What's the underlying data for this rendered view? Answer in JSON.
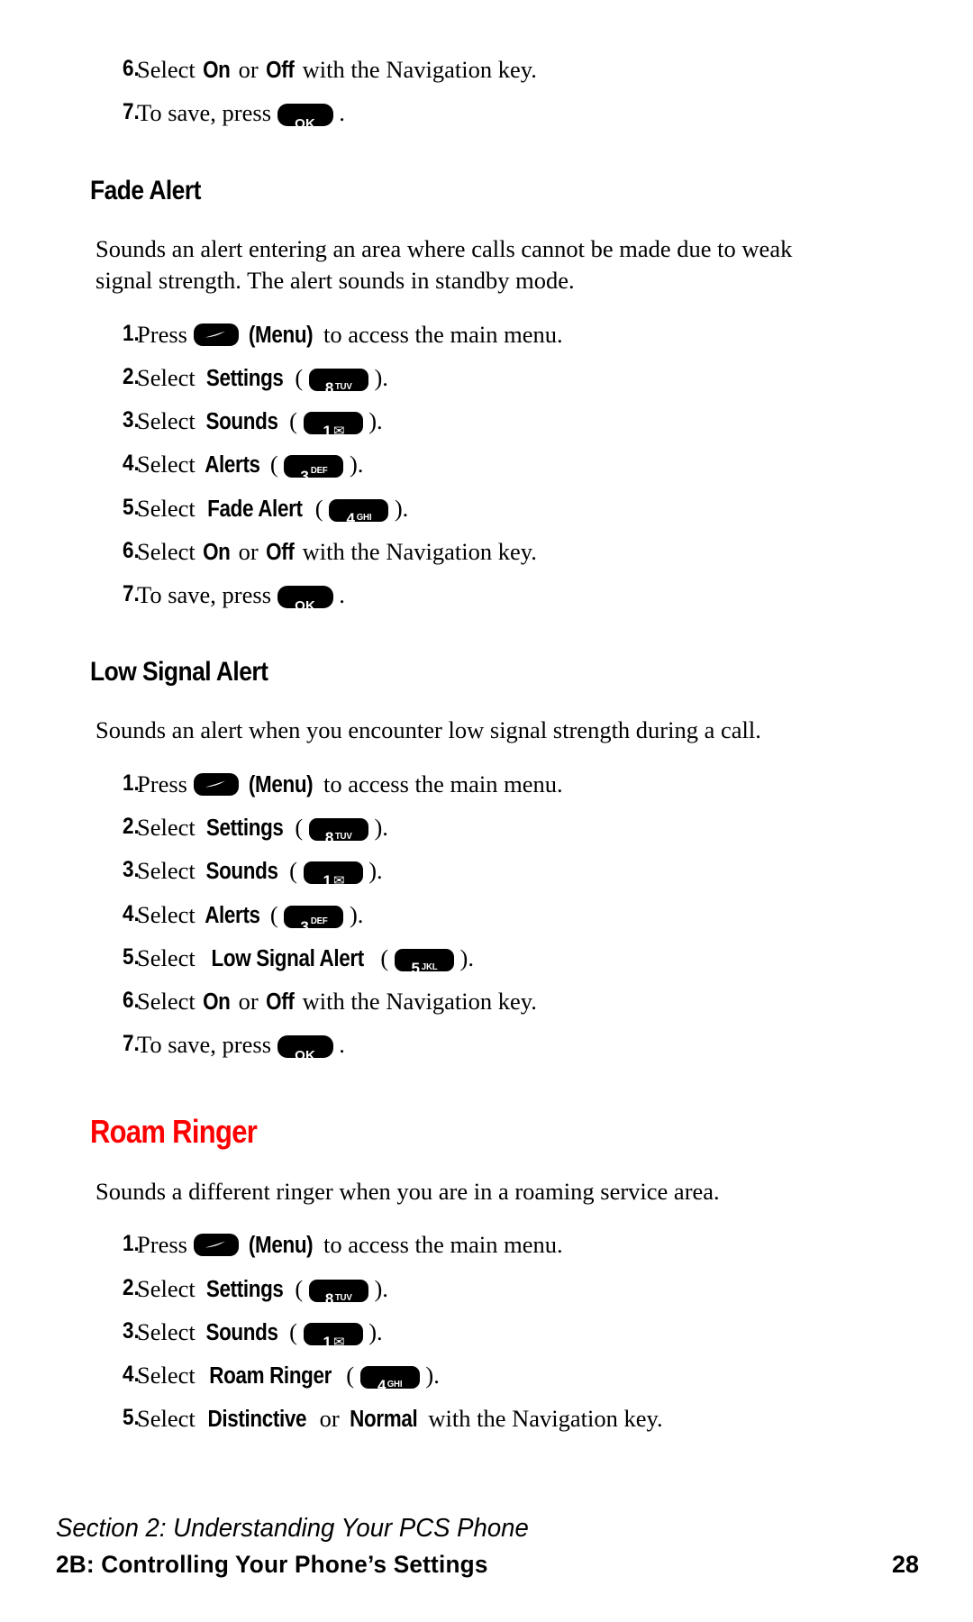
{
  "page": {
    "number": "28",
    "accent_color": "#ff0000",
    "text_color": "#000000",
    "background": "#ffffff"
  },
  "top_steps": [
    {
      "num": "6.",
      "pre": "Select ",
      "bold1": "On",
      "mid": " or ",
      "bold2": "Off",
      "post": " with the Navigation key."
    },
    {
      "num": "7.",
      "pre": "To save, press ",
      "key": "OK",
      "post": " ."
    }
  ],
  "sections": [
    {
      "heading": "Fade Alert",
      "heading_color": "#000000",
      "body": "Sounds an alert entering an area where calls cannot be made due to weak signal strength. The alert sounds in standby mode.",
      "steps": [
        {
          "num": "1.",
          "pre": "Press ",
          "key_type": "menu",
          "post_bold": "(Menu)",
          "post": " to access the main menu."
        },
        {
          "num": "2.",
          "pre": "Select ",
          "bold": "Settings",
          "paren_open": " ( ",
          "key_digit": "8",
          "key_letters": "TUV",
          "paren_close": " )."
        },
        {
          "num": "3.",
          "pre": "Select ",
          "bold": "Sounds",
          "paren_open": " ( ",
          "key_digit": "1",
          "key_letters": "envelope-glyph",
          "paren_close": " )."
        },
        {
          "num": "4.",
          "pre": "Select ",
          "bold": "Alerts",
          "paren_open": " ( ",
          "key_digit": "3",
          "key_letters": "DEF",
          "paren_close": " )."
        },
        {
          "num": "5.",
          "pre": "Select ",
          "bold": "Fade Alert",
          "paren_open": " ( ",
          "key_digit": "4",
          "key_letters": "GHI",
          "paren_close": " )."
        },
        {
          "num": "6.",
          "pre": "Select ",
          "bold": "On",
          "mid": " or ",
          "bold2": "Off",
          "post": " with the Navigation key."
        },
        {
          "num": "7.",
          "pre": "To save, press ",
          "key_ok": "OK",
          "post": " ."
        }
      ]
    },
    {
      "heading": "Low Signal Alert",
      "heading_color": "#000000",
      "body": "Sounds an alert when you encounter low signal strength during a call.",
      "steps": [
        {
          "num": "1.",
          "pre": "Press ",
          "key_type": "menu",
          "post_bold": "(Menu)",
          "post": " to access the main menu."
        },
        {
          "num": "2.",
          "pre": "Select ",
          "bold": "Settings",
          "paren_open": " ( ",
          "key_digit": "8",
          "key_letters": "TUV",
          "paren_close": " )."
        },
        {
          "num": "3.",
          "pre": "Select ",
          "bold": "Sounds",
          "paren_open": " ( ",
          "key_digit": "1",
          "key_letters": "envelope-glyph",
          "paren_close": " )."
        },
        {
          "num": "4.",
          "pre": "Select ",
          "bold": "Alerts",
          "paren_open": " ( ",
          "key_digit": "3",
          "key_letters": "DEF",
          "paren_close": " )."
        },
        {
          "num": "5.",
          "pre": "Select ",
          "bold": "Low Signal Alert",
          "paren_open": " ( ",
          "key_digit": "5",
          "key_letters": "JKL",
          "paren_close": " )."
        },
        {
          "num": "6.",
          "pre": "Select ",
          "bold": "On",
          "mid": " or ",
          "bold2": "Off",
          "post": " with the Navigation key."
        },
        {
          "num": "7.",
          "pre": "To save, press ",
          "key_ok": "OK",
          "post": " ."
        }
      ]
    }
  ],
  "major_section": {
    "heading": "Roam Ringer",
    "heading_color": "#ff0000",
    "body": "Sounds a different ringer when you are in a roaming service area.",
    "steps": [
      {
        "num": "1.",
        "pre": "Press ",
        "key_type": "menu",
        "post_bold": "(Menu)",
        "post": " to access the main menu."
      },
      {
        "num": "2.",
        "pre": "Select ",
        "bold": "Settings",
        "paren_open": " ( ",
        "key_digit": "8",
        "key_letters": "TUV",
        "paren_close": " )."
      },
      {
        "num": "3.",
        "pre": "Select ",
        "bold": "Sounds",
        "paren_open": " ( ",
        "key_digit": "1",
        "key_letters": "envelope-glyph",
        "paren_close": " )."
      },
      {
        "num": "4.",
        "pre": "Select ",
        "bold": "Roam Ringer",
        "paren_open": " ( ",
        "key_digit": "4",
        "key_letters": "GHI",
        "paren_close": " )."
      },
      {
        "num": "5.",
        "pre": "Select ",
        "bold": "Distinctive",
        "mid": " or ",
        "bold2": "Normal",
        "post": " with the Navigation key."
      }
    ]
  },
  "footer": {
    "section_line": "Section 2: Understanding Your PCS Phone",
    "chapter_line": "2B: Controlling Your Phone’s Settings",
    "page_number": "28"
  },
  "labels": {
    "select": "Select",
    "press": "Press",
    "to_save": "To save, press",
    "or": "or",
    "with_nav": "with the Navigation key."
  }
}
